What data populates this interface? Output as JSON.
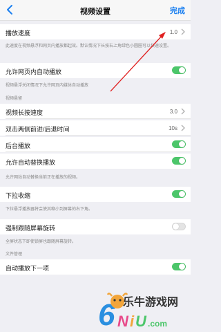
{
  "nav": {
    "title": "视频设置",
    "done_label": "完成"
  },
  "playback_speed": {
    "label": "播放速度",
    "value": "1.0",
    "note": "此速度在视频悬浮和网页内播放都起效。默认情况下长按右上角绿色小圆圈可以快速设置。"
  },
  "autoplay_web": {
    "label": "允许网页内自动播放",
    "enabled": true,
    "note": "视频悬浮关闭情况下允许网页内媒体自动播放"
  },
  "section_float": "视频悬留",
  "long_press_speed": {
    "label": "视频长按速度",
    "value": "3.0"
  },
  "double_tap": {
    "label": "双击两侧前进/后退时间",
    "value": "10s"
  },
  "background_play": {
    "label": "后台播放",
    "enabled": true
  },
  "auto_replace": {
    "label": "允许自动替换播放",
    "enabled": true,
    "note": "允许网站自动替换当前正在播放的视频。"
  },
  "pull_down_minimize": {
    "label": "下拉收缩",
    "enabled": true,
    "note": "下拉悬浮播放器将会使其缩小到屏幕的右下角。"
  },
  "force_rotate": {
    "label": "强制跟随屏幕旋转",
    "enabled": false,
    "note": "全屏状态下即使锁屏也跟随屏幕旋转。"
  },
  "section_files": "文件管理",
  "autoplay_next": {
    "label": "自动播放下一项",
    "enabled": true
  },
  "watermark": {
    "text": "乐牛游戏网"
  },
  "colors": {
    "accent": "#1a7ff0",
    "toggle_on": "#4cc66a",
    "annotation_arrow": "#e02020"
  }
}
